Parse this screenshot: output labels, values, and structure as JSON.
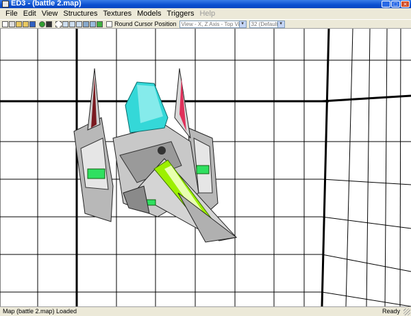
{
  "window": {
    "title": "ED3 - (battle 2.map)"
  },
  "menu": [
    "File",
    "Edit",
    "View",
    "Structures",
    "Textures",
    "Models",
    "Triggers",
    "Help"
  ],
  "toolbar": {
    "icons": [
      "new-icon",
      "open-icon",
      "open-folder-icon",
      "save-folder-icon",
      "save-icon",
      "sphere-icon",
      "grid-icon",
      "select-icon",
      "move-icon",
      "rotate-icon",
      "scale-icon",
      "texture-icon",
      "model-icon",
      "settings-icon"
    ],
    "round_cursor_label": "Round Cursor Position",
    "round_cursor_checked": false,
    "view_select": "View - X, Z Axis - Top View",
    "grid_select": "32 (Default)"
  },
  "status": {
    "left": "Map (battle 2.map) Loaded",
    "right": "Ready"
  },
  "colors": {
    "titlebar": "#0a4fd0",
    "hull": "#c8c8c8",
    "canopy": "#34d8d8",
    "glow": "#9cf000",
    "green": "#2fe060",
    "magenta": "#e0305a"
  }
}
